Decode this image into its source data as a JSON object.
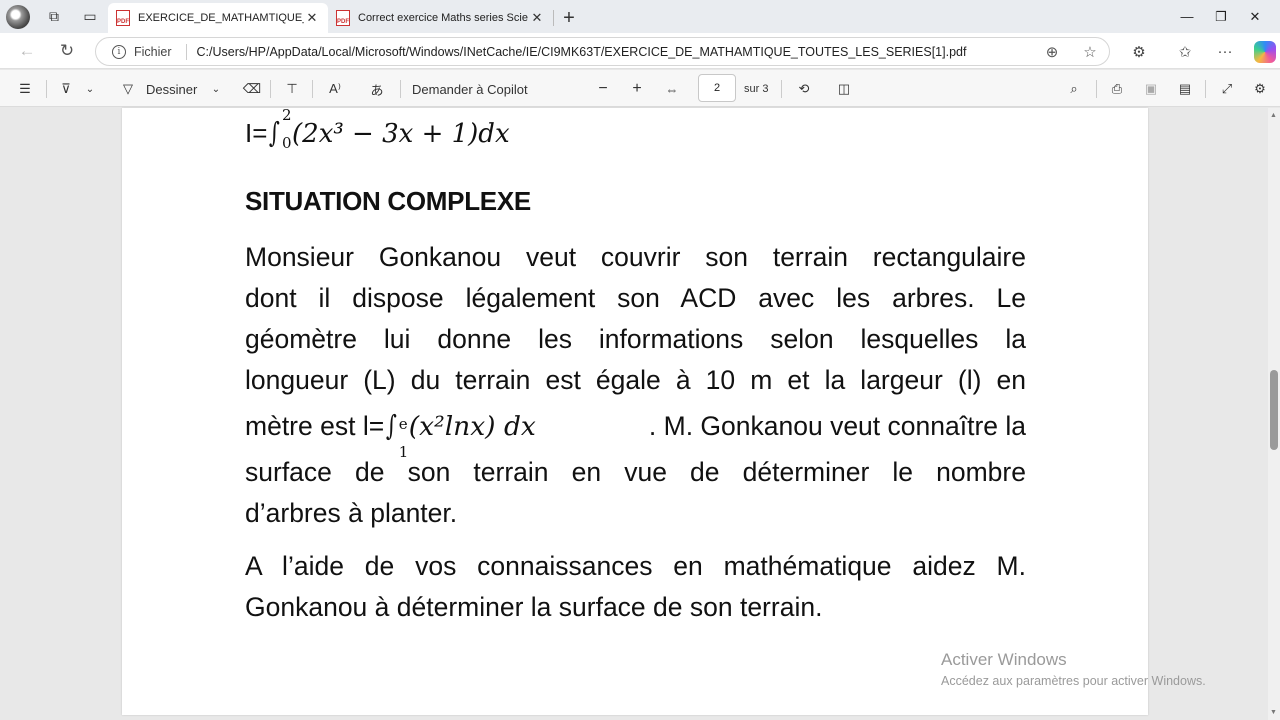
{
  "tabs": [
    {
      "title": "EXERCICE_DE_MATHAMTIQUE_TOUTES_LES_SERIES[1].pdf",
      "short": "EXERCICE_DE_MATHAMTIQUE_TO",
      "active": true
    },
    {
      "title": "Correct exercice Maths series Scie",
      "short": "Correct exercice Maths series Scie",
      "active": false
    }
  ],
  "address": {
    "scheme_label": "Fichier",
    "url": "C:/Users/HP/AppData/Local/Microsoft/Windows/INetCache/IE/CI9MK63T/EXERCICE_DE_MATHAMTIQUE_TOUTES_LES_SERIES[1].pdf"
  },
  "pdf_toolbar": {
    "draw_label": "Dessiner",
    "copilot_label": "Demander à Copilot",
    "page_current": "2",
    "page_total_label": "sur 3"
  },
  "document": {
    "formula_prefix": "I=",
    "formula_upper": "2",
    "formula_lower": "0",
    "formula_body": "(2x³ − 3x + 1)dx",
    "heading": "SITUATION COMPLEXE",
    "para1_lines": [
      "Monsieur  Gonkanou veut couvrir son terrain rectangulaire",
      "dont il dispose légalement son ACD avec les arbres. Le",
      "géomètre lui donne les informations selon lesquelles la",
      "longueur (L) du terrain est égale à 10 m et la largeur (l) en"
    ],
    "para1_inline_prefix": "mètre est l=",
    "para1_integral_upper": "e",
    "para1_integral_lower": "1",
    "para1_integral_body": "(x²lnx) dx",
    "para1_inline_suffix": ".   M. Gonkanou veut connaître la",
    "para1_tail_lines": [
      "surface de son terrain en vue de déterminer le nombre",
      "d’arbres à planter."
    ],
    "para2_lines": [
      "A l’aide de vos connaissances en mathématique aidez M.",
      "Gonkanou à déterminer la surface de son terrain."
    ]
  },
  "watermark": {
    "title": "Activer Windows",
    "subtitle": "Accédez aux paramètres pour activer Windows."
  }
}
